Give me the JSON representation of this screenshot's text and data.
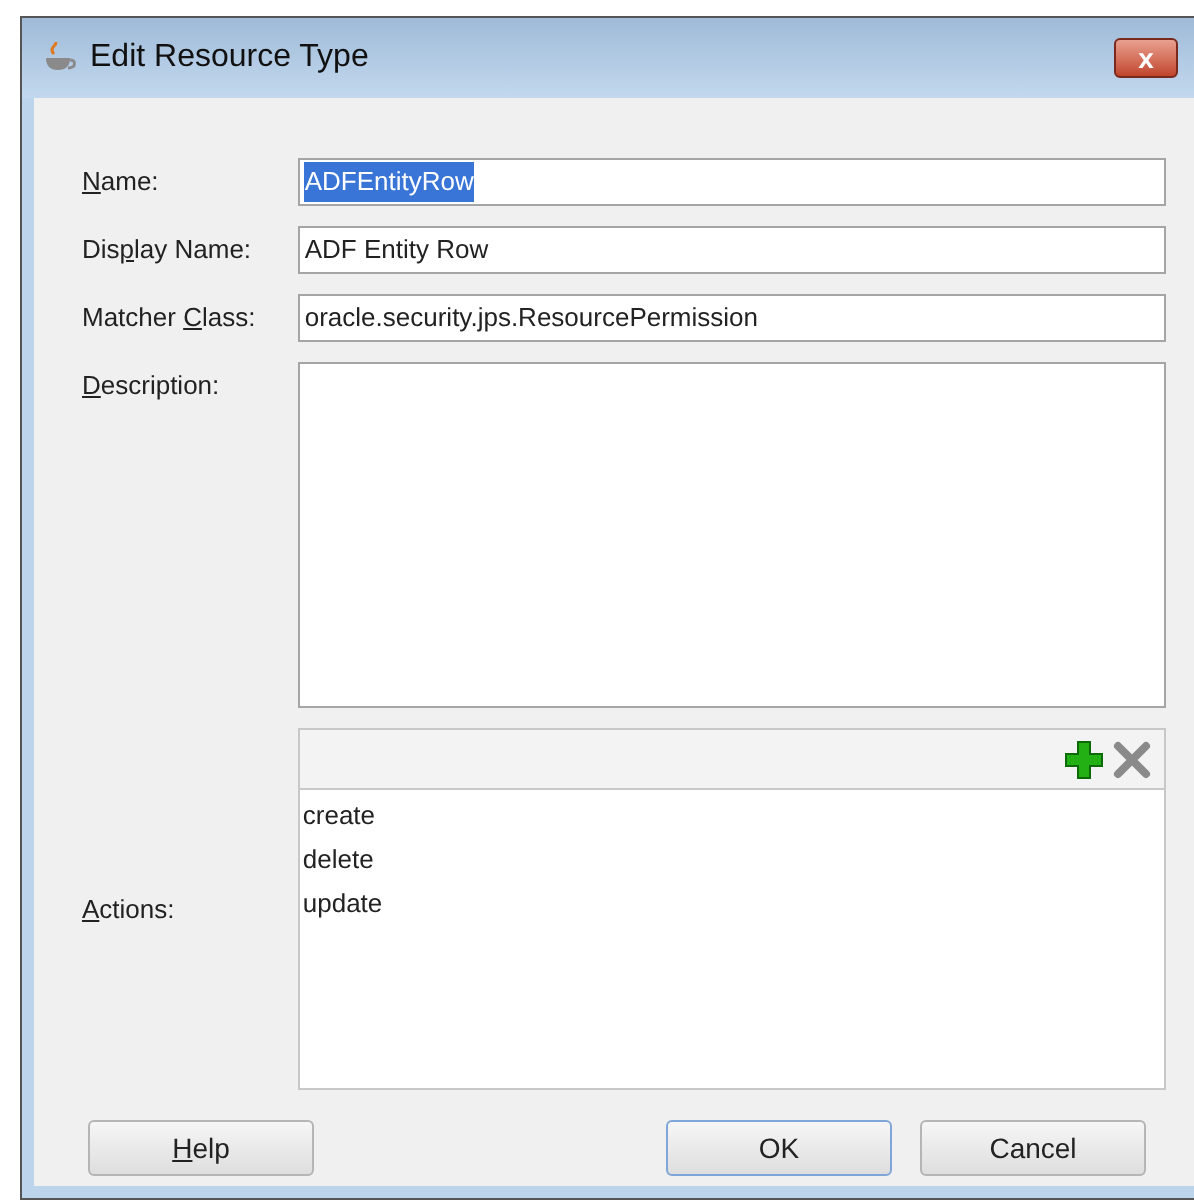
{
  "window": {
    "title": "Edit Resource Type",
    "close_button": "x"
  },
  "fields": [
    {
      "kind": "line",
      "label": {
        "key": "N",
        "post": "ame:"
      },
      "value": "ADFEntityRow",
      "text_selected": true
    },
    {
      "kind": "line",
      "label": {
        "pre": "Dis",
        "key": "p",
        "post": "lay Name:"
      },
      "value": "ADF Entity Row"
    },
    {
      "kind": "line",
      "label": {
        "pre": "Matcher ",
        "key": "C",
        "post": "lass:"
      },
      "value": "oracle.security.jps.ResourcePermission"
    },
    {
      "kind": "area",
      "label": {
        "key": "D",
        "post": "escription:"
      }
    }
  ],
  "actions": {
    "label": {
      "key": "A",
      "post": "ctions:"
    },
    "items": [
      "create",
      "delete",
      "update"
    ]
  },
  "left_buttons": [
    {
      "label": {
        "key": "H",
        "post": "elp"
      },
      "default": false
    }
  ],
  "right_buttons": [
    {
      "label": {
        "pre": "OK"
      },
      "default": true
    },
    {
      "label": {
        "pre": "Cancel"
      },
      "default": false
    }
  ]
}
